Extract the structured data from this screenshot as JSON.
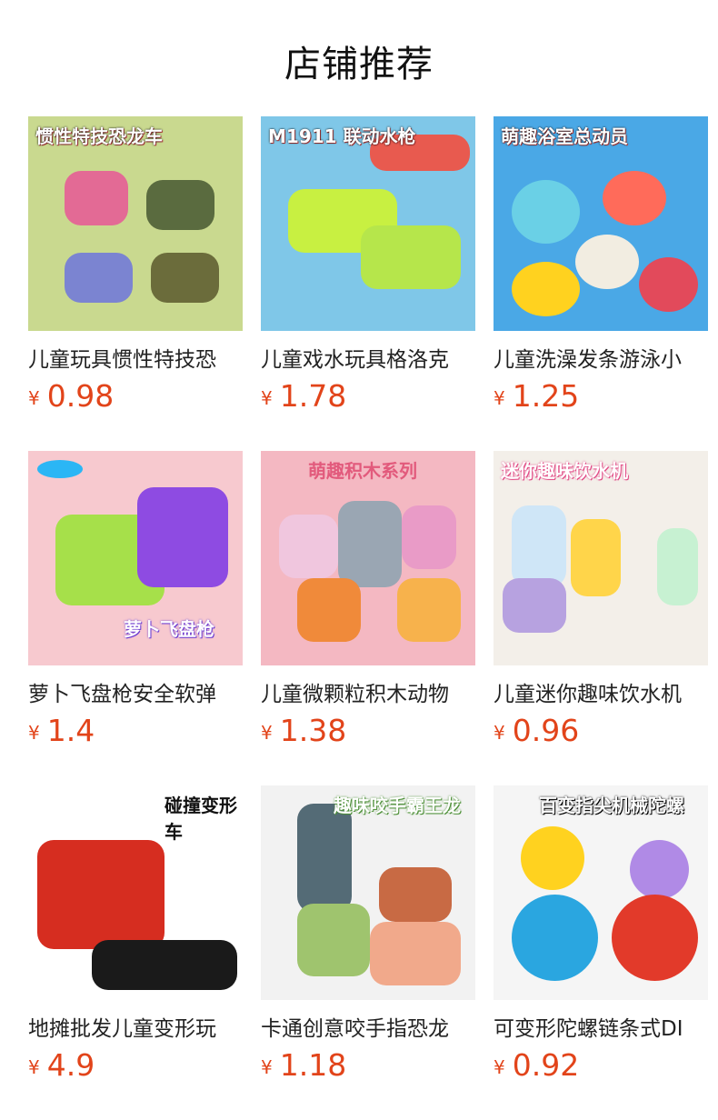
{
  "page": {
    "title": "店铺推荐"
  },
  "currency": "¥",
  "products": [
    {
      "name": "儿童玩具惯性特技恐",
      "price": "0.98",
      "thumb_text": "惯性特技恐龙车",
      "bg": "#c9d98f",
      "accent": "#e36a95"
    },
    {
      "name": "儿童戏水玩具格洛克",
      "price": "1.78",
      "thumb_text": "M1911 联动水枪",
      "bg": "#7fc7e8",
      "accent": "#e85a4f"
    },
    {
      "name": "儿童洗澡发条游泳小",
      "price": "1.25",
      "thumb_text": "萌趣浴室总动员",
      "bg": "#4aa8e6",
      "accent": "#ffd21f"
    },
    {
      "name": "萝卜飞盘枪安全软弹",
      "price": "1.4",
      "thumb_text": "萝卜飞盘枪",
      "bg": "#f7c9cf",
      "accent": "#9b5de5"
    },
    {
      "name": "儿童微颗粒积木动物",
      "price": "1.38",
      "thumb_text": "萌趣积木系列",
      "bg": "#f4b8c2",
      "accent": "#7a8fa6"
    },
    {
      "name": "儿童迷你趣味饮水机",
      "price": "0.96",
      "thumb_text": "迷你趣味饮水机",
      "bg": "#f3efe9",
      "accent": "#b7a2e0"
    },
    {
      "name": "地摊批发儿童变形玩",
      "price": "4.9",
      "thumb_text": "碰撞变形车",
      "bg": "#ffffff",
      "accent": "#d62d20"
    },
    {
      "name": "卡通创意咬手指恐龙",
      "price": "1.18",
      "thumb_text": "趣味咬手霸王龙",
      "bg": "#f2f2f2",
      "accent": "#7bb36a"
    },
    {
      "name": "可变形陀螺链条式DI",
      "price": "0.92",
      "thumb_text": "百变指尖机械陀螺",
      "bg": "#f5f5f5",
      "accent": "#2aa6e0"
    }
  ]
}
